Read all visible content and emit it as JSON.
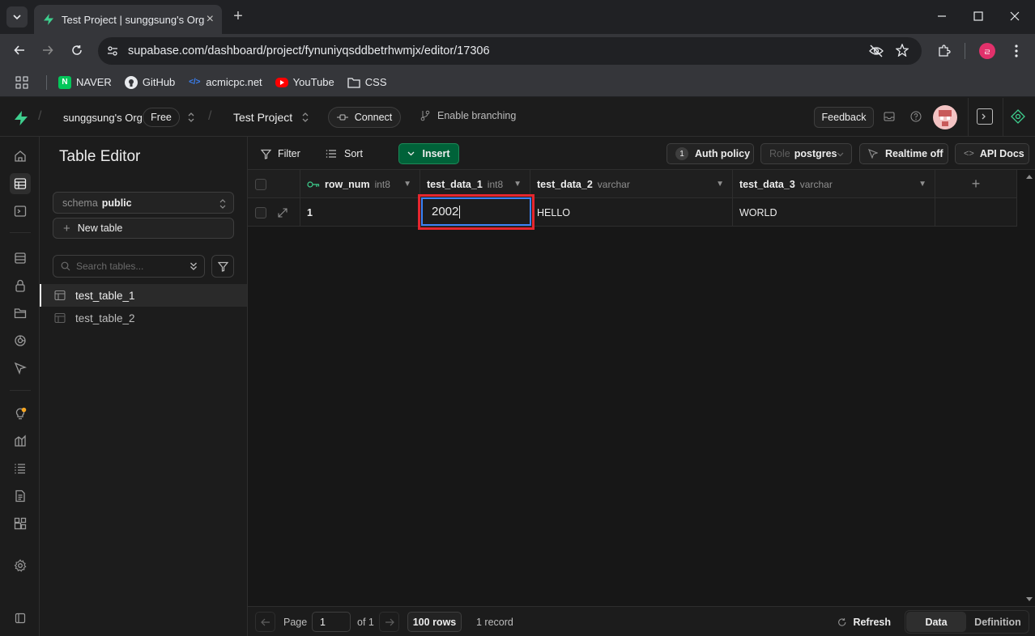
{
  "browser": {
    "tab_title": "Test Project | sunggsung's Org",
    "url": "supabase.com/dashboard/project/fynuniyqsddbetrhwmjx/editor/17306",
    "profile_initial": "ㄹ",
    "bookmarks": [
      {
        "label": "NAVER",
        "icon": "naver-icon"
      },
      {
        "label": "GitHub",
        "icon": "github-icon"
      },
      {
        "label": "acmicpc.net",
        "icon": "code-icon"
      },
      {
        "label": "YouTube",
        "icon": "youtube-icon"
      },
      {
        "label": "CSS",
        "icon": "folder-icon"
      }
    ]
  },
  "header": {
    "org_name": "sunggsung's Org",
    "plan_badge": "Free",
    "project_name": "Test Project",
    "connect_label": "Connect",
    "branching_label": "Enable branching",
    "feedback_label": "Feedback"
  },
  "side": {
    "title": "Table Editor",
    "schema_prefix": "schema",
    "schema_value": "public",
    "new_table_label": "New table",
    "search_placeholder": "Search tables...",
    "tables": [
      {
        "name": "test_table_1",
        "active": true
      },
      {
        "name": "test_table_2",
        "active": false
      }
    ]
  },
  "toolbar": {
    "filter_label": "Filter",
    "sort_label": "Sort",
    "insert_label": "Insert",
    "auth_count": "1",
    "auth_label": "Auth policy",
    "role_prefix": "Role",
    "role_value": "postgres",
    "realtime_label": "Realtime off",
    "api_docs_label": "API Docs"
  },
  "grid": {
    "columns": [
      {
        "name": "row_num",
        "type": "int8",
        "primary_key": true
      },
      {
        "name": "test_data_1",
        "type": "int8"
      },
      {
        "name": "test_data_2",
        "type": "varchar"
      },
      {
        "name": "test_data_3",
        "type": "varchar"
      }
    ],
    "rows": [
      {
        "row_num": "1",
        "test_data_1": "2002",
        "test_data_2": "HELLO",
        "test_data_3": "WORLD"
      }
    ],
    "editing_value": "2002"
  },
  "footer": {
    "page_label": "Page",
    "page_value": "1",
    "of_label": "of 1",
    "rows_label": "100 rows",
    "record_count": "1 record",
    "refresh_label": "Refresh",
    "data_tab": "Data",
    "definition_tab": "Definition"
  },
  "colors": {
    "brand_green": "#3ecf8e",
    "insert_bg": "#006239",
    "highlight_red": "#e5262f",
    "edit_border": "#3b82f6"
  }
}
